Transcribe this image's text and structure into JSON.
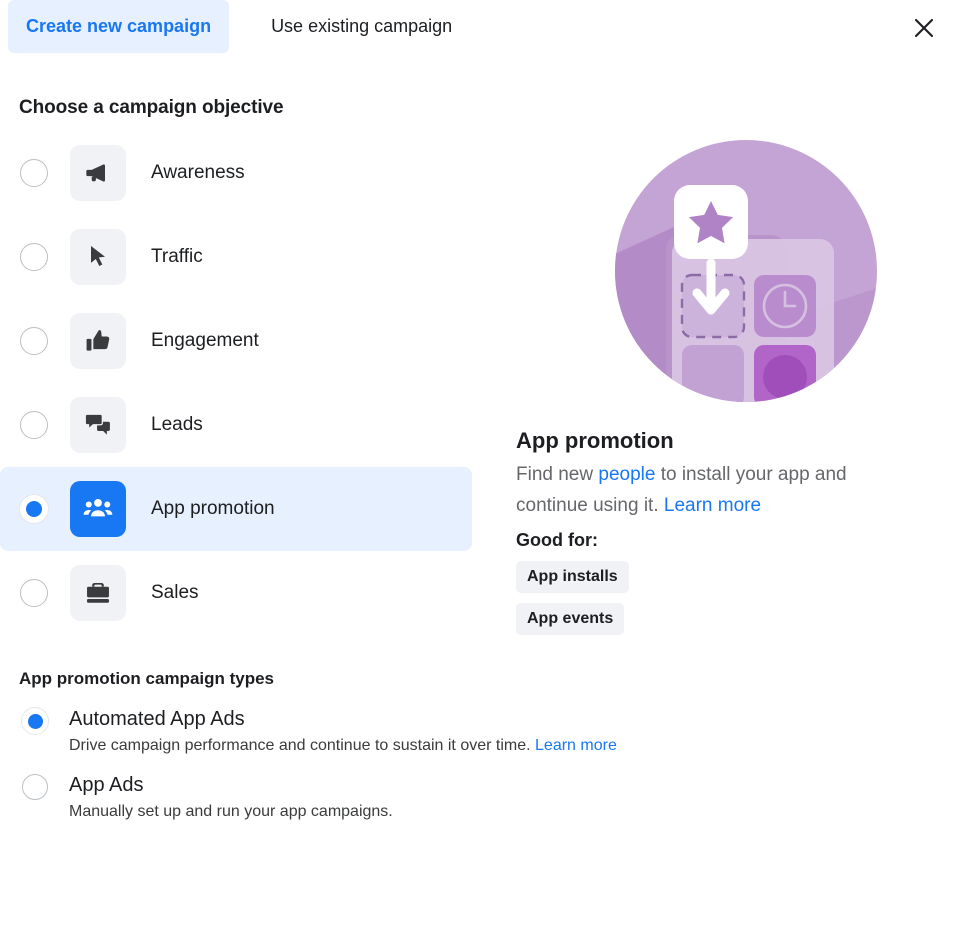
{
  "tabs": [
    {
      "label": "Create new campaign",
      "active": true,
      "name": "tab-create-new-campaign"
    },
    {
      "label": "Use existing campaign",
      "active": false,
      "name": "tab-use-existing-campaign"
    }
  ],
  "close_icon": "close-icon",
  "section": {
    "title": "Choose a campaign objective"
  },
  "objectives": [
    {
      "label": "Awareness",
      "icon": "megaphone-icon",
      "selected": false
    },
    {
      "label": "Traffic",
      "icon": "cursor-icon",
      "selected": false
    },
    {
      "label": "Engagement",
      "icon": "thumbs-up-icon",
      "selected": false
    },
    {
      "label": "Leads",
      "icon": "chat-bubbles-icon",
      "selected": false
    },
    {
      "label": "App promotion",
      "icon": "people-group-icon",
      "selected": true
    },
    {
      "label": "Sales",
      "icon": "briefcase-icon",
      "selected": false
    }
  ],
  "detail": {
    "illustration": "app-install-illustration",
    "title": "App promotion",
    "desc_part1": "Find new ",
    "desc_link1": "people",
    "desc_part2": " to install your app and continue using it. ",
    "desc_link2": "Learn more",
    "good_for_label": "Good for:",
    "badges": [
      "App installs",
      "App events"
    ]
  },
  "campaign_types": {
    "title": "App promotion campaign types",
    "options": [
      {
        "name": "Automated App Ads",
        "desc": "Drive campaign performance and continue to sustain it over time. ",
        "link": "Learn more",
        "selected": true
      },
      {
        "name": "App Ads",
        "desc": "Manually set up and run your app campaigns.",
        "link": "",
        "selected": false
      }
    ]
  },
  "colors": {
    "accent_blue": "#1877f2",
    "tab_active_bg": "#e7f0fe",
    "tile_bg": "#f0f2f5",
    "text_primary": "#1c1e21",
    "text_secondary": "#65676b",
    "illustration_purple": "#b491c8"
  }
}
